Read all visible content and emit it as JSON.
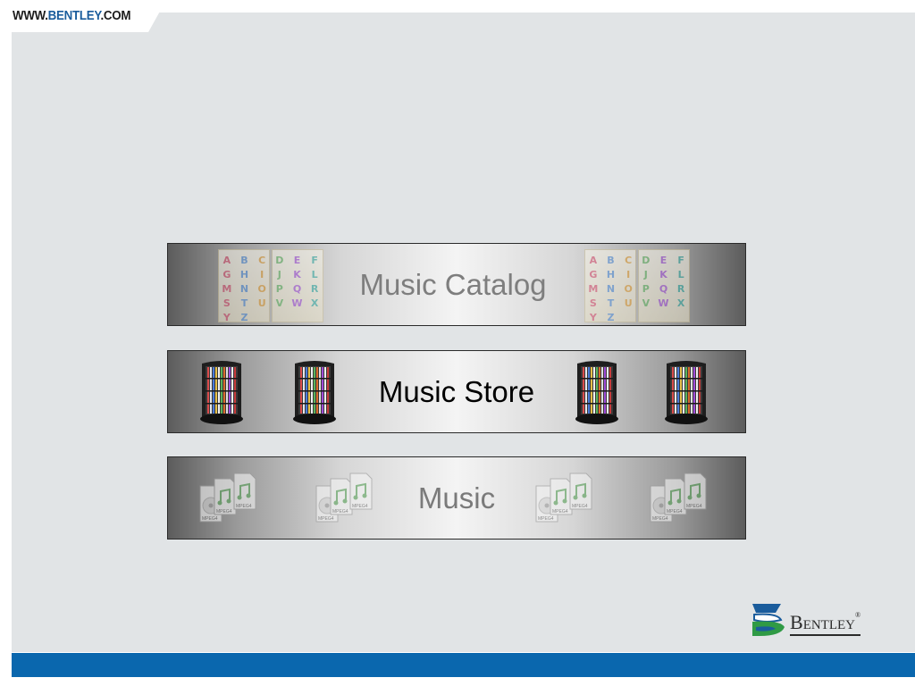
{
  "header": {
    "url_prefix": "WWW.",
    "url_brand": "BENTLEY",
    "url_suffix": ".COM"
  },
  "bands": [
    {
      "label": "Music Catalog",
      "icon": "alphabet-blocks-icon"
    },
    {
      "label": "Music Store",
      "icon": "cd-rack-icon"
    },
    {
      "label": "Music",
      "icon": "mpeg4-file-icon"
    }
  ],
  "alphabet": [
    "A",
    "B",
    "C",
    "D",
    "E",
    "F",
    "G",
    "H",
    "I",
    "J",
    "K",
    "L",
    "M",
    "N",
    "O",
    "P",
    "Q",
    "R",
    "S",
    "T",
    "U",
    "V",
    "W",
    "X",
    "Y",
    "Z"
  ],
  "mpeg_label": "MPEG4",
  "logo": {
    "word_first": "B",
    "word_rest": "ENTLEY",
    "reg": "®"
  },
  "colors": {
    "brand_blue": "#0a67ae",
    "slide_bg": "#e1e4e6",
    "logo_green": "#2f9a45"
  }
}
